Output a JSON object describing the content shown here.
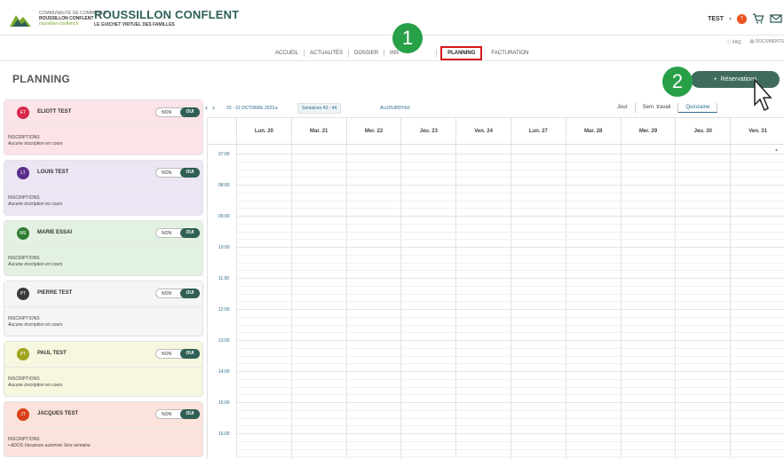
{
  "header": {
    "logo_lines": [
      "COMMUNAUTÉ DE COMMUNES",
      "ROUSSILLON CONFLENT",
      "roussillon-conflent.fr"
    ],
    "brand_title": "ROUSSILLON CONFLENT",
    "brand_sub": "LE GUICHET VIRTUEL DES FAMILLES",
    "user_name": "TEST",
    "user_caret": "▾",
    "user_initials": "T",
    "faq": "FAQ",
    "documents": "DOCUMENTS"
  },
  "nav": {
    "items": [
      "ACCUEIL",
      "ACTUALITÉS",
      "DOSSIER",
      "INS",
      "PLANNING",
      "FACTURATION"
    ]
  },
  "steps": [
    "1",
    "2"
  ],
  "page_title": "PLANNING",
  "reservations_button": "Réservations",
  "reservations_plus": "+",
  "children": [
    {
      "initials": "ET",
      "name": "ELIOTT TEST",
      "non": "NON",
      "oui": "OUI",
      "insc_label": "INSCRIPTIONS",
      "insc_status": "Aucune inscription en cours",
      "color": "#d6284a",
      "bg": "#fbe3e8"
    },
    {
      "initials": "LT",
      "name": "LOUIS TEST",
      "non": "NON",
      "oui": "OUI",
      "insc_label": "INSCRIPTIONS",
      "insc_status": "Aucune inscription en cours",
      "color": "#5a2d8c",
      "bg": "#ece5f3"
    },
    {
      "initials": "ME",
      "name": "MARIE ESSAI",
      "non": "NON",
      "oui": "OUI",
      "insc_label": "INSCRIPTIONS",
      "insc_status": "Aucune inscription en cours",
      "color": "#2e7d32",
      "bg": "#e3f1e3"
    },
    {
      "initials": "PT",
      "name": "PIERRE TEST",
      "non": "NON",
      "oui": "OUI",
      "insc_label": "INSCRIPTIONS",
      "insc_status": "Aucune inscription en cours",
      "color": "#3a3a3a",
      "bg": "#f5f5f5"
    },
    {
      "initials": "PT",
      "name": "PAUL TEST",
      "non": "NON",
      "oui": "OUI",
      "insc_label": "INSCRIPTIONS",
      "insc_status": "Aucune inscription en cours",
      "color": "#a0a31e",
      "bg": "#f7f6df"
    },
    {
      "initials": "JT",
      "name": "JACQUES TEST",
      "non": "NON",
      "oui": "OUI",
      "insc_label": "INSCRIPTIONS",
      "insc_status": "• ADOS Vacances automne 1ère semaine",
      "color": "#d8401a",
      "bg": "#fbe2da"
    }
  ],
  "toolbar": {
    "prev": "‹",
    "next": "›",
    "range": "20 - 31 OCTOBRE 2023 ▸",
    "weeks": "Semaines 43 - 44",
    "today": "AUJOURD'HUI",
    "views": [
      "Jour",
      "Sem. travail",
      "Quinzaine"
    ],
    "active_view": "Quinzaine"
  },
  "calendar": {
    "days": [
      "Lun. 20",
      "Mar. 21",
      "Mer. 22",
      "Jeu. 23",
      "Ven. 24",
      "Lun. 27",
      "Mar. 28",
      "Mer. 29",
      "Jeu. 30",
      "Ven. 31"
    ],
    "hours": [
      "07:00",
      "08:00",
      "09:00",
      "10:00",
      "11:00",
      "12:00",
      "13:00",
      "14:00",
      "15:00",
      "16:00"
    ],
    "scroll_arrow": "▲"
  }
}
